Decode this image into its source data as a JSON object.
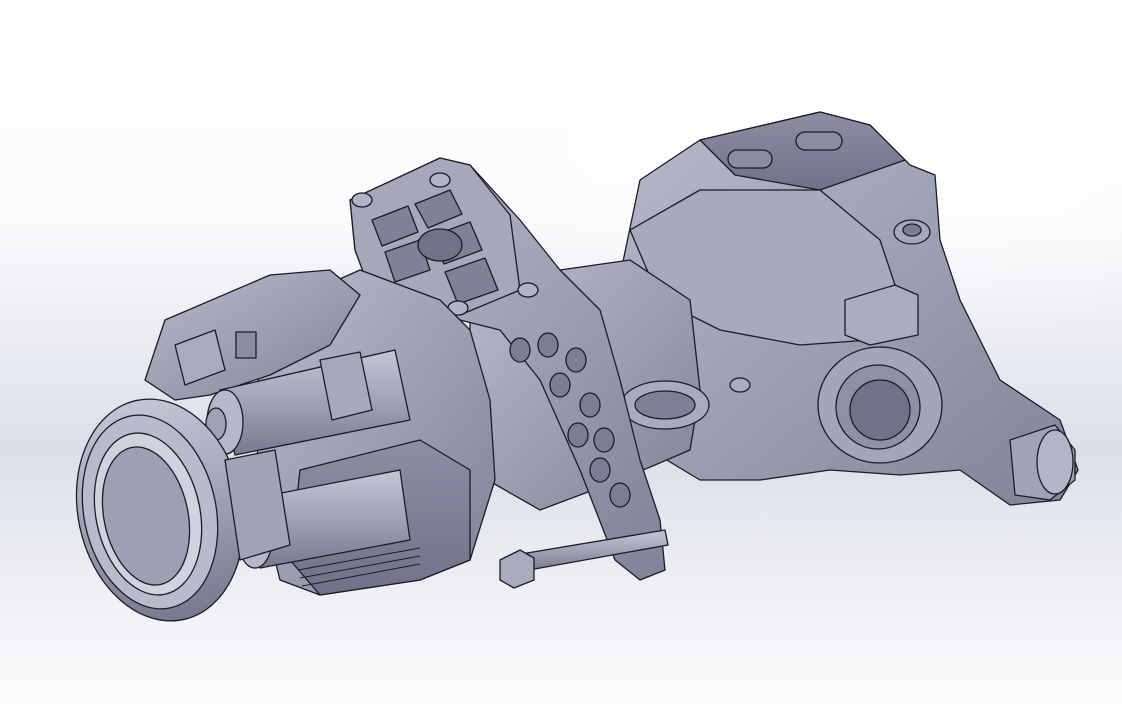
{
  "view": {
    "background_top": "#ffffff",
    "background_mid": "#dcdfe9",
    "part_fill": "#9a9db1",
    "part_light": "#b4b7c9",
    "part_dark": "#7d8096",
    "edge_color": "#1c1c24"
  }
}
